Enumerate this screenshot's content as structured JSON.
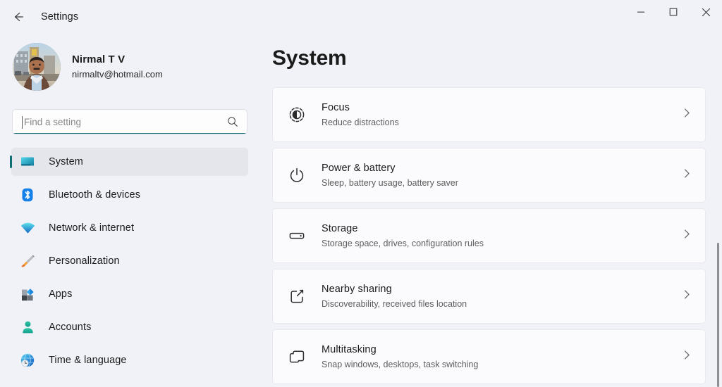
{
  "window": {
    "title": "Settings",
    "back_icon": "back-arrow-icon",
    "controls": {
      "minimize": "minimize-icon",
      "maximize": "maximize-icon",
      "close": "close-icon"
    }
  },
  "theme": {
    "page_bg": "#f0f2f7",
    "card_bg": "#fbfbfd",
    "accent": "#0d6e73",
    "selected_bg": "#e4e6eb",
    "text_primary": "#1b1b1b",
    "text_secondary": "#5d5d5d"
  },
  "profile": {
    "name": "Nirmal T V",
    "email": "nirmaltv@hotmail.com",
    "avatar": "user-avatar-photo"
  },
  "search": {
    "placeholder": "Find a setting",
    "value": "",
    "icon": "search-icon",
    "focused": true
  },
  "sidebar": {
    "items": [
      {
        "label": "System",
        "icon": "monitor-icon",
        "selected": true
      },
      {
        "label": "Bluetooth & devices",
        "icon": "bluetooth-icon",
        "selected": false
      },
      {
        "label": "Network & internet",
        "icon": "wifi-icon",
        "selected": false
      },
      {
        "label": "Personalization",
        "icon": "paintbrush-icon",
        "selected": false
      },
      {
        "label": "Apps",
        "icon": "apps-icon",
        "selected": false
      },
      {
        "label": "Accounts",
        "icon": "person-icon",
        "selected": false
      },
      {
        "label": "Time & language",
        "icon": "globe-clock-icon",
        "selected": false
      }
    ]
  },
  "main": {
    "title": "System",
    "cards": [
      {
        "title": "Focus",
        "subtitle": "Reduce distractions",
        "icon": "focus-icon",
        "chevron": "chevron-right-icon"
      },
      {
        "title": "Power & battery",
        "subtitle": "Sleep, battery usage, battery saver",
        "icon": "power-icon",
        "chevron": "chevron-right-icon"
      },
      {
        "title": "Storage",
        "subtitle": "Storage space, drives, configuration rules",
        "icon": "storage-drive-icon",
        "chevron": "chevron-right-icon"
      },
      {
        "title": "Nearby sharing",
        "subtitle": "Discoverability, received files location",
        "icon": "share-icon",
        "chevron": "chevron-right-icon"
      },
      {
        "title": "Multitasking",
        "subtitle": "Snap windows, desktops, task switching",
        "icon": "multitasking-windows-icon",
        "chevron": "chevron-right-icon"
      }
    ]
  },
  "scrollbar": {
    "name": "vertical-scrollbar"
  }
}
